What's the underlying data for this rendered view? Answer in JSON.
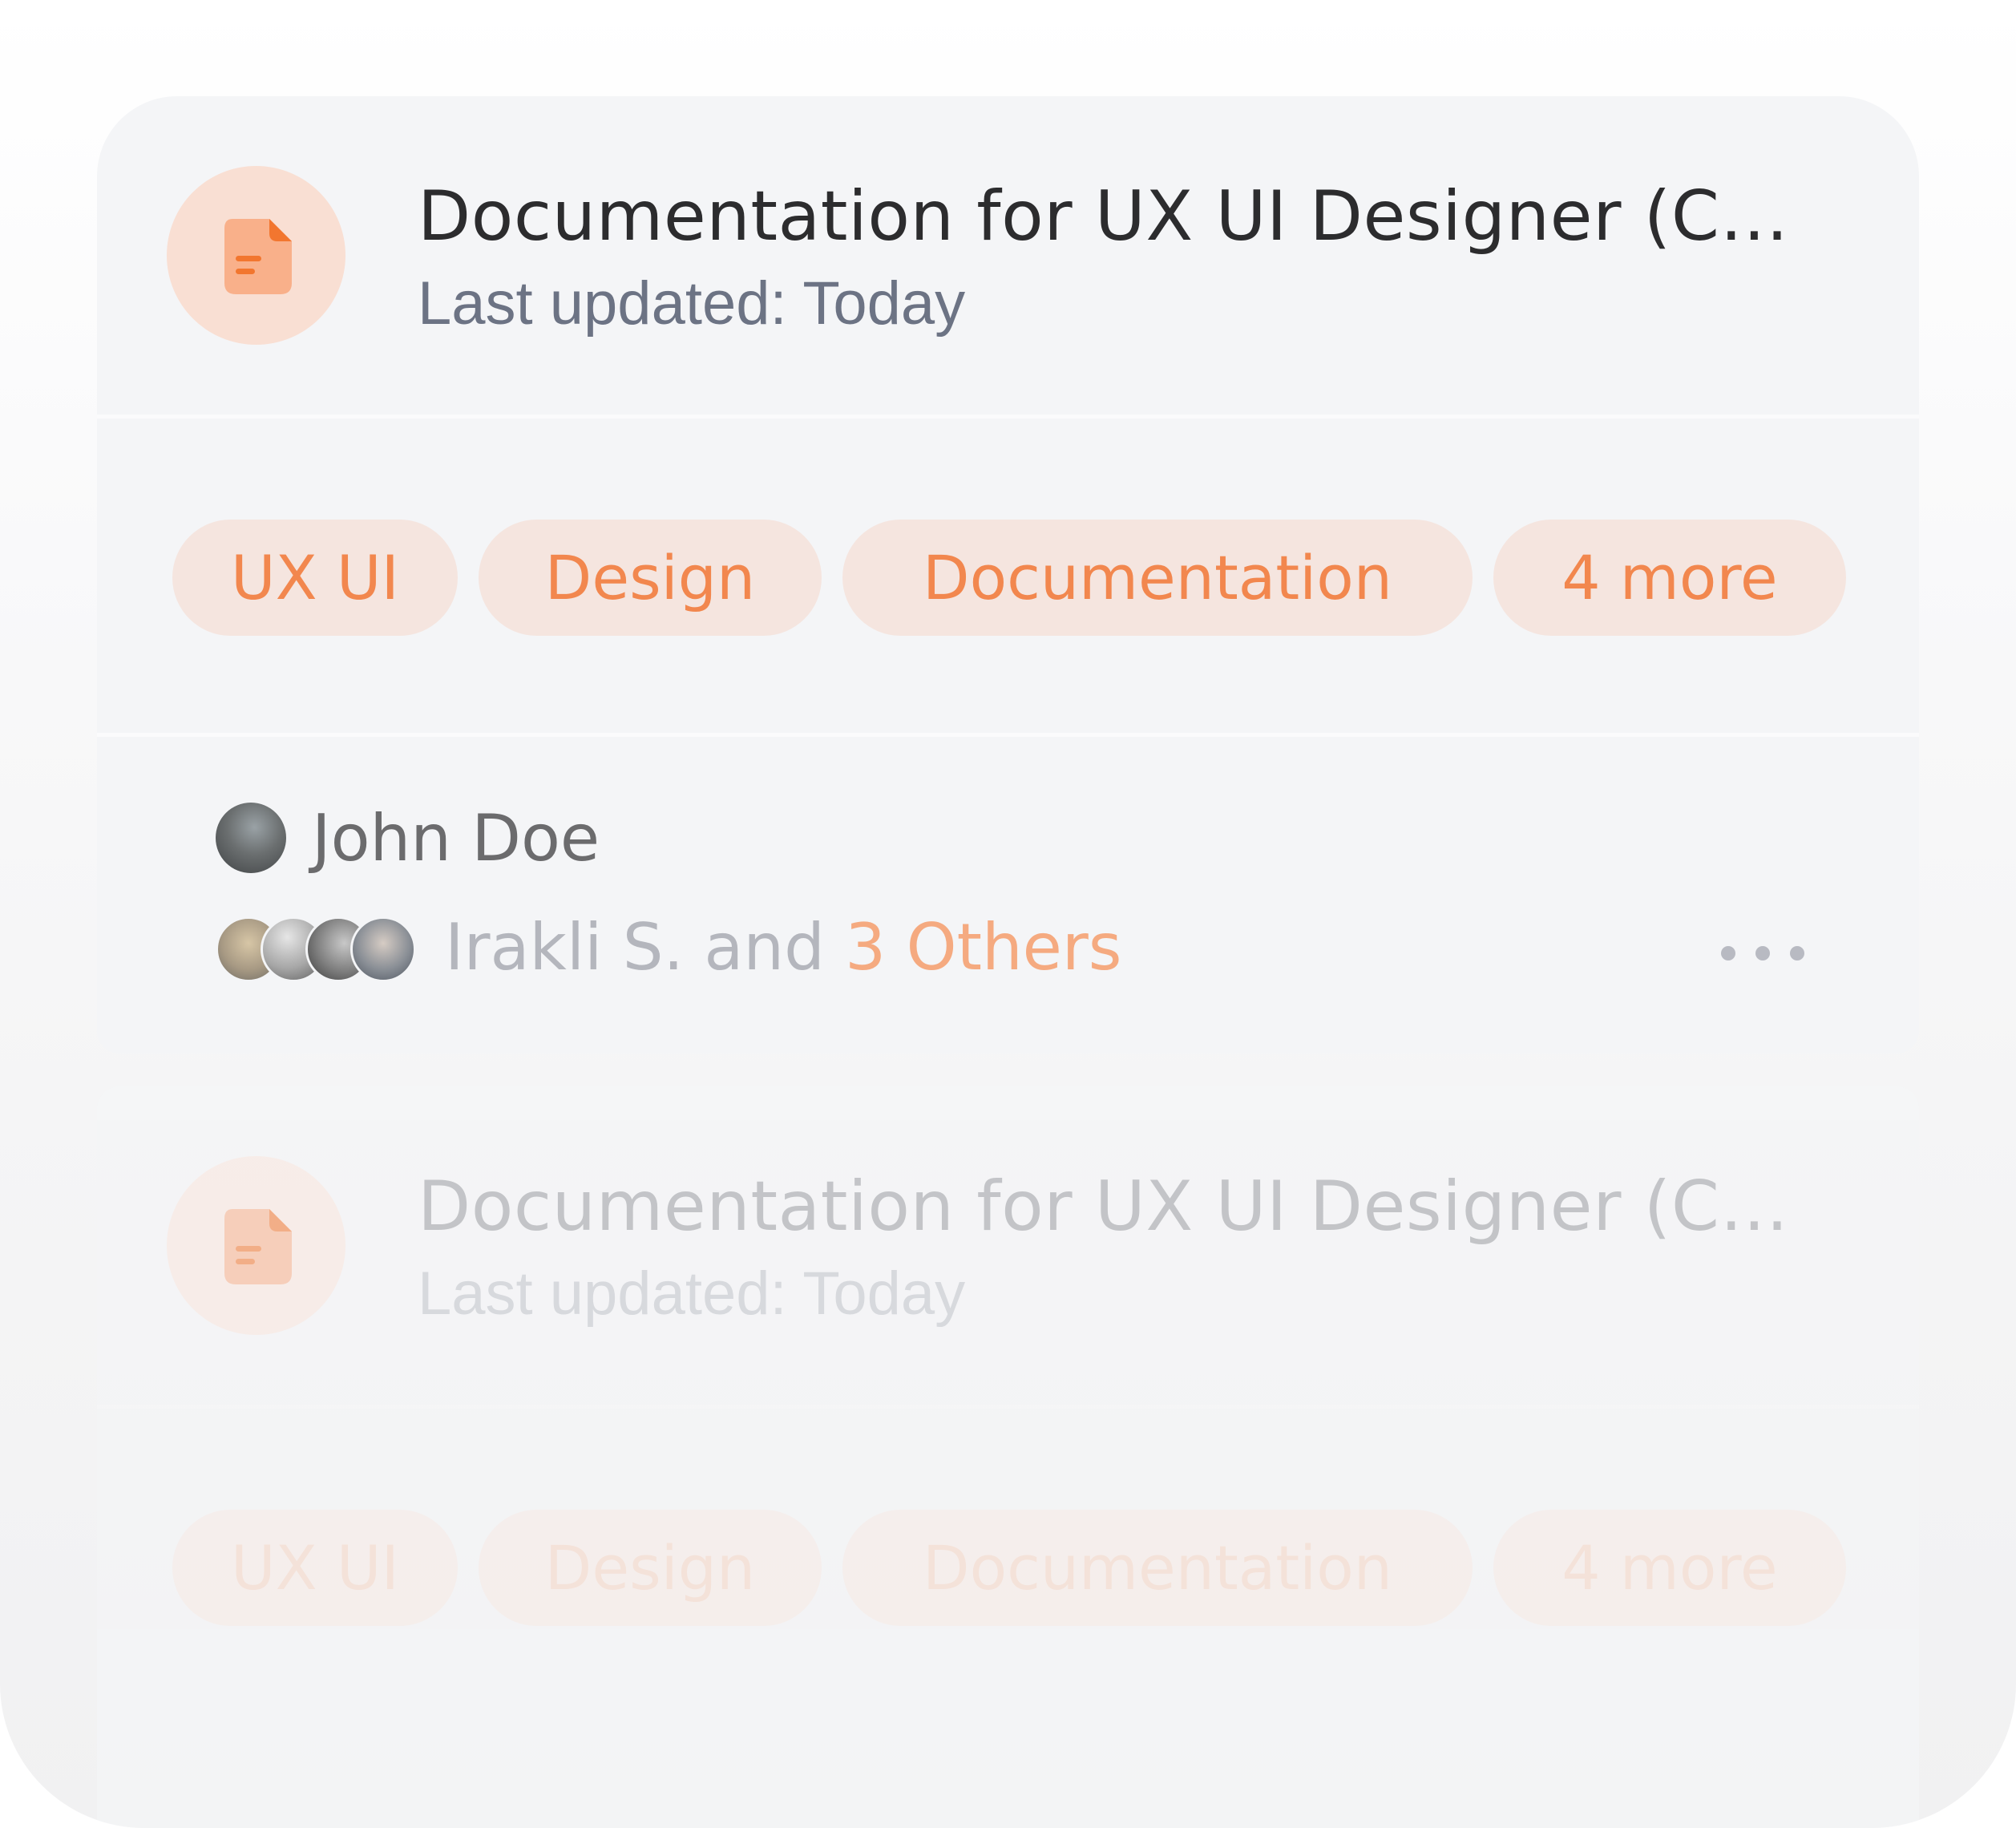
{
  "documents": [
    {
      "title": "Documentation for UX UI Designer (Company Guidelines)",
      "updated": "Last updated: Today",
      "tags": [
        "UX UI",
        "Design",
        "Documentation",
        "4 more"
      ],
      "owner": "John Doe",
      "collaborators_prefix": "Irakli S. and ",
      "collaborators_others": "3 Others",
      "icon": "document-icon"
    },
    {
      "title": "Documentation for UX UI Designer (Company Guidelines)",
      "updated": "Last updated: Today",
      "tags": [
        "UX UI",
        "Design",
        "Documentation",
        "4 more"
      ],
      "icon": "document-icon"
    }
  ],
  "colors": {
    "accent": "#f2874e",
    "tag_bg": "#f5e5df",
    "card_bg": "#f4f5f7",
    "title": "#2c2c2e",
    "muted": "#6c7384"
  }
}
